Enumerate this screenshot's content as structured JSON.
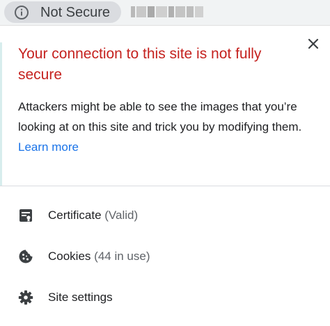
{
  "omnibox": {
    "security_label": "Not Secure",
    "url_obscured": true
  },
  "popup": {
    "close_icon": "close-icon",
    "title": "Your connection to this site is not fully secure",
    "body": "Attackers might be able to see the images that you’re looking at on this site and trick you by modifying them.",
    "learn_more": "Learn more",
    "items": [
      {
        "icon": "certificate-icon",
        "label": "Certificate",
        "detail": "(Valid)"
      },
      {
        "icon": "cookie-icon",
        "label": "Cookies",
        "detail": "(44 in use)"
      },
      {
        "icon": "gear-icon",
        "label": "Site settings",
        "detail": ""
      }
    ]
  },
  "colors": {
    "warning": "#c5221f",
    "link": "#1a73e8",
    "chip_bg": "#dadce0",
    "text": "#202124",
    "secondary_text": "#5f6368"
  }
}
